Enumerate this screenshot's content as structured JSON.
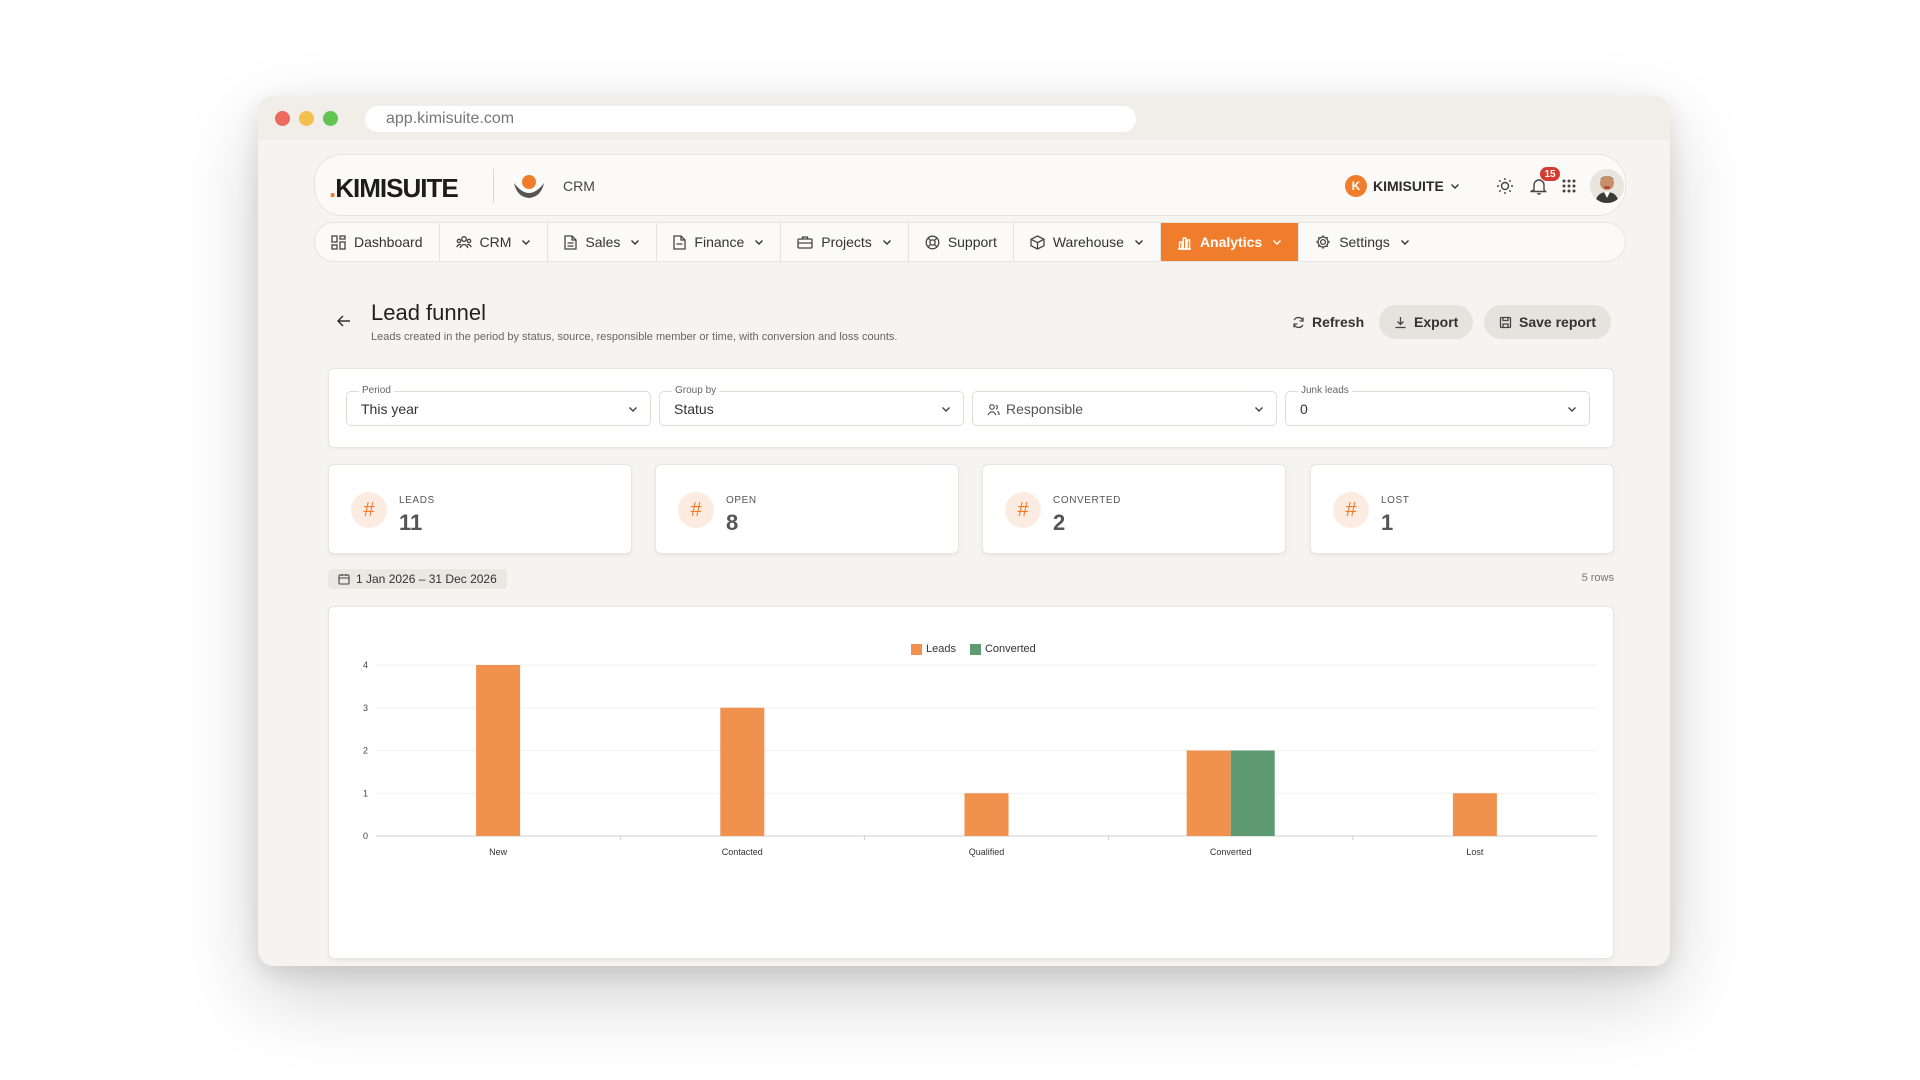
{
  "browser": {
    "url": "app.kimisuite.com"
  },
  "header": {
    "logo_text": "KIMISUITE",
    "module": "CRM",
    "org_initial": "K",
    "org_name": "KIMISUITE",
    "notification_count": "15"
  },
  "nav": [
    {
      "label": "Dashboard",
      "icon": "dashboard-icon",
      "dropdown": false,
      "active": false
    },
    {
      "label": "CRM",
      "icon": "users-icon",
      "dropdown": true,
      "active": false
    },
    {
      "label": "Sales",
      "icon": "document-icon",
      "dropdown": true,
      "active": false
    },
    {
      "label": "Finance",
      "icon": "invoice-icon",
      "dropdown": true,
      "active": false
    },
    {
      "label": "Projects",
      "icon": "briefcase-icon",
      "dropdown": true,
      "active": false
    },
    {
      "label": "Support",
      "icon": "lifebuoy-icon",
      "dropdown": false,
      "active": false
    },
    {
      "label": "Warehouse",
      "icon": "box-icon",
      "dropdown": true,
      "active": false
    },
    {
      "label": "Analytics",
      "icon": "bar-chart-icon",
      "dropdown": true,
      "active": true
    },
    {
      "label": "Settings",
      "icon": "gear-icon",
      "dropdown": true,
      "active": false
    }
  ],
  "page": {
    "title": "Lead funnel",
    "subtitle": "Leads created in the period by status, source, responsible member or time, with conversion and loss counts."
  },
  "actions": {
    "refresh": "Refresh",
    "export": "Export",
    "save": "Save report"
  },
  "filters": {
    "period": {
      "label": "Period",
      "value": "This year"
    },
    "group_by": {
      "label": "Group by",
      "value": "Status"
    },
    "responsible": {
      "placeholder": "Responsible"
    },
    "junk": {
      "label": "Junk leads",
      "value": "0"
    }
  },
  "kpis": [
    {
      "label": "LEADS",
      "value": "11"
    },
    {
      "label": "OPEN",
      "value": "8"
    },
    {
      "label": "CONVERTED",
      "value": "2"
    },
    {
      "label": "LOST",
      "value": "1"
    }
  ],
  "date_range": "1 Jan 2026 – 31 Dec 2026",
  "rows_count": "5 rows",
  "colors": {
    "accent": "#ef7d2b",
    "leads": "#f0914e",
    "converted": "#5e9a72"
  },
  "chart_data": {
    "type": "bar",
    "categories": [
      "New",
      "Contacted",
      "Qualified",
      "Converted",
      "Lost"
    ],
    "series": [
      {
        "name": "Leads",
        "values": [
          4,
          3,
          1,
          2,
          1
        ]
      },
      {
        "name": "Converted",
        "values": [
          0,
          0,
          0,
          2,
          0
        ]
      }
    ],
    "yticks": [
      "0",
      "1",
      "2",
      "3",
      "4"
    ],
    "ylim": [
      0,
      4
    ],
    "legend": "top-center",
    "grid": true
  }
}
